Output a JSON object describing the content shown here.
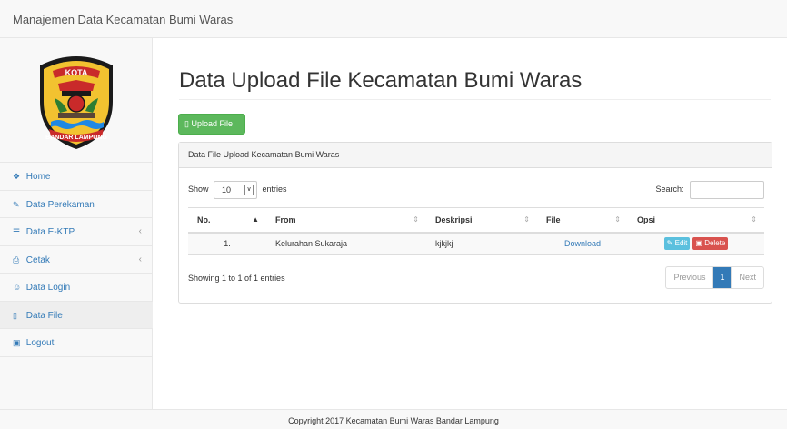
{
  "navbar": {
    "brand": "Manajemen Data Kecamatan Bumi Waras"
  },
  "logo": {
    "top_text": "KOTA",
    "bottom_text": "BANDAR LAMPUNG"
  },
  "sidebar": {
    "items": [
      {
        "icon": "dashboard-icon",
        "glyph": "❖",
        "label": "Home",
        "has_submenu": false,
        "active": false
      },
      {
        "icon": "edit-icon",
        "glyph": "✎",
        "label": "Data Perekaman",
        "has_submenu": false,
        "active": false
      },
      {
        "icon": "table-icon",
        "glyph": "☰",
        "label": "Data E-KTP",
        "has_submenu": true,
        "active": false
      },
      {
        "icon": "print-icon",
        "glyph": "⎙",
        "label": "Cetak",
        "has_submenu": true,
        "active": false
      },
      {
        "icon": "user-icon",
        "glyph": "☺",
        "label": "Data Login",
        "has_submenu": false,
        "active": false
      },
      {
        "icon": "file-icon",
        "glyph": "▯",
        "label": "Data File",
        "has_submenu": false,
        "active": true
      },
      {
        "icon": "lock-icon",
        "glyph": "▣",
        "label": "Logout",
        "has_submenu": false,
        "active": false
      }
    ],
    "submenu_chevron": "‹"
  },
  "main": {
    "title": "Data Upload File Kecamatan Bumi Waras",
    "upload_button": "Upload File",
    "panel_title": "Data File Upload Kecamatan Bumi Waras",
    "length": {
      "show": "Show",
      "value": "10",
      "entries": "entries"
    },
    "search_label": "Search:",
    "table": {
      "columns": [
        {
          "label": "No.",
          "sort": "▲",
          "sorted": true
        },
        {
          "label": "From",
          "sort": "⇕",
          "sorted": false
        },
        {
          "label": "Deskripsi",
          "sort": "⇕",
          "sorted": false
        },
        {
          "label": "File",
          "sort": "⇕",
          "sorted": false
        },
        {
          "label": "Opsi",
          "sort": "⇕",
          "sorted": false
        }
      ],
      "rows": [
        {
          "no": "1.",
          "from": "Kelurahan Sukaraja",
          "deskripsi": "kjkjkj",
          "file": "Download",
          "edit": "Edit",
          "delete": "Delete"
        }
      ]
    },
    "info": "Showing 1 to 1 of 1 entries",
    "pagination": {
      "previous": "Previous",
      "current": "1",
      "next": "Next"
    }
  },
  "footer": {
    "text": "Copyright 2017 Kecamatan Bumi Waras Bandar Lampung"
  },
  "colors": {
    "primary": "#337ab7",
    "success": "#5cb85c",
    "info": "#5bc0de",
    "danger": "#d9534f"
  }
}
